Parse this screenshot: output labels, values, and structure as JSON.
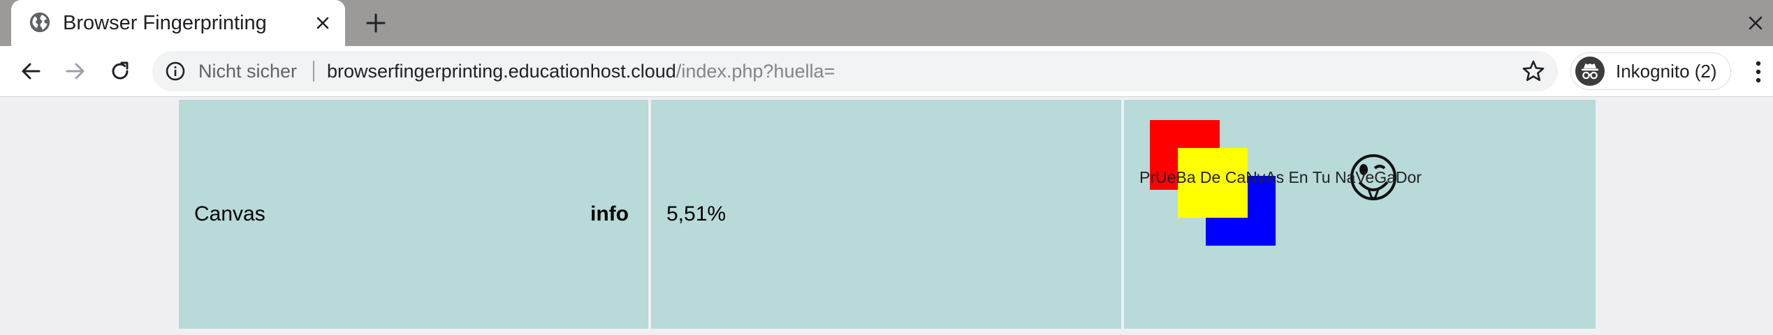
{
  "browser": {
    "tab": {
      "title": "Browser Fingerprinting",
      "favicon": "globe-icon"
    },
    "toolbar": {
      "security_label": "Nicht sicher",
      "url_host": "browserfingerprinting.educationhost.cloud",
      "url_path": "/index.php?huella=",
      "incognito_label": "Inkognito (2)"
    }
  },
  "row": {
    "feature": "Canvas",
    "info_label": "info",
    "percentage": "5,51%",
    "canvas_text": "PrUeBa De CaNvAs En Tu NaVeGaDor"
  },
  "colors": {
    "cell_bg": "#b8dad9",
    "page_bg": "#f0eff4",
    "square_red": "#ff0000",
    "square_yellow": "#ffff00",
    "square_blue": "#0000ff"
  }
}
